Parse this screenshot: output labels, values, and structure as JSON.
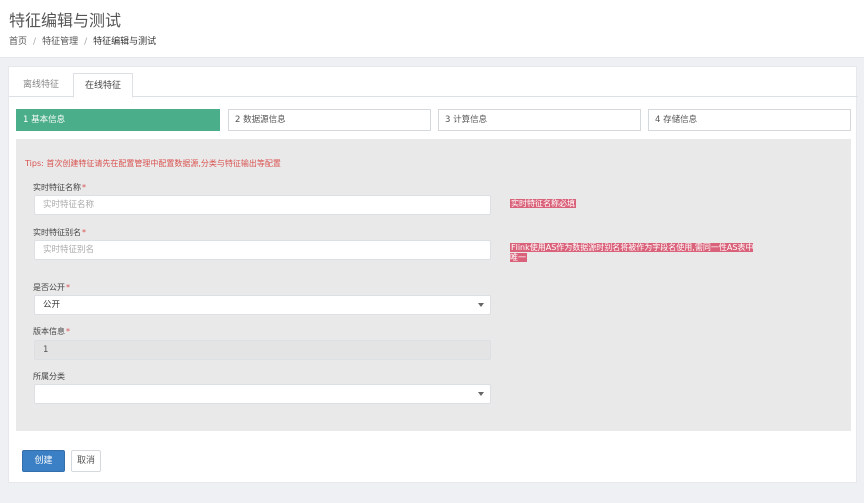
{
  "header": {
    "title": "特征编辑与测试",
    "breadcrumb": [
      "首页",
      "特征管理",
      "特征编辑与测试"
    ]
  },
  "tabs": [
    {
      "label": "离线特征",
      "active": false
    },
    {
      "label": "在线特征",
      "active": true
    }
  ],
  "steps": [
    {
      "label": "1 基本信息",
      "active": true
    },
    {
      "label": "2 数据源信息",
      "active": false
    },
    {
      "label": "3 计算信息",
      "active": false
    },
    {
      "label": "4 存储信息",
      "active": false
    }
  ],
  "form": {
    "tips": "Tips: 首次创建特征请先在配置管理中配置数据源,分类与特征输出等配置",
    "name": {
      "label": "实时特征名称",
      "required": "*",
      "placeholder": "实时特征名称",
      "error": "实时特征名称必填"
    },
    "alias": {
      "label": "实时特征别名",
      "required": "*",
      "placeholder": "实时特征别名",
      "error": "Flink使用AS作为数据源时别名将被作为字段名使用,需同一性AS表中唯一"
    },
    "public": {
      "label": "是否公开",
      "required": "*",
      "value": "公开"
    },
    "version": {
      "label": "版本信息",
      "required": "*",
      "value": "1"
    },
    "category": {
      "label": "所属分类",
      "value": ""
    }
  },
  "buttons": {
    "create": "创建",
    "cancel": "取消"
  },
  "colors": {
    "step_active": "#4bae8a",
    "primary": "#3b7fc4",
    "error": "#d9534f"
  }
}
